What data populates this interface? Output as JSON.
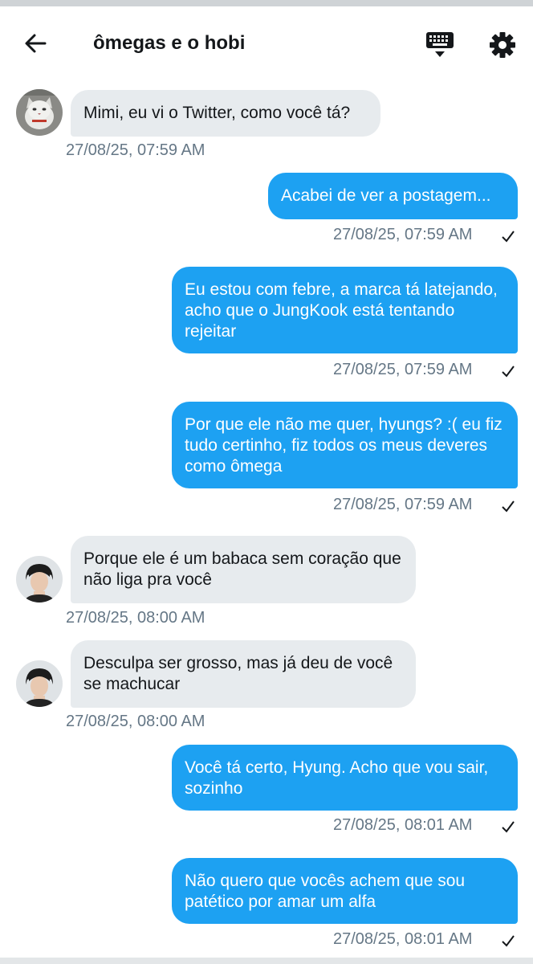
{
  "header": {
    "title": "ômegas e o hobi"
  },
  "messages": [
    {
      "side": "in",
      "text": "Mimi, eu vi o Twitter, como você tá?",
      "time": "27/08/25, 07:59 AM",
      "avatar": "cat-avatar"
    },
    {
      "side": "out",
      "text": "Acabei de ver a postagem...",
      "time": "27/08/25, 07:59 AM"
    },
    {
      "side": "out",
      "text": "Eu estou com febre, a marca tá latejando, acho que o JungKook está tentando rejeitar",
      "time": "27/08/25, 07:59 AM"
    },
    {
      "side": "out",
      "text": "Por que ele não me quer, hyungs? :( eu fiz tudo certinho, fiz todos os meus deveres como ômega",
      "time": "27/08/25, 07:59 AM"
    },
    {
      "side": "in",
      "text": "Porque ele é um babaca sem coração que não liga pra você",
      "time": "27/08/25, 08:00 AM",
      "avatar": "person-avatar"
    },
    {
      "side": "in",
      "text": "Desculpa ser grosso, mas já deu de você se machucar",
      "time": "27/08/25, 08:00 AM",
      "avatar": "person-avatar"
    },
    {
      "side": "out",
      "text": "Você tá certo, Hyung. Acho que vou sair, sozinho",
      "time": "27/08/25, 08:01 AM"
    },
    {
      "side": "out",
      "text": "Não quero que vocês achem que sou patético por amar um alfa",
      "time": "27/08/25, 08:01 AM"
    }
  ],
  "colors": {
    "outgoing_bubble": "#1da1f2",
    "incoming_bubble": "#e7ebee",
    "timestamp": "#657786"
  },
  "icons": [
    "back-arrow-icon",
    "keyboard-icon",
    "gear-icon",
    "check-icon"
  ]
}
